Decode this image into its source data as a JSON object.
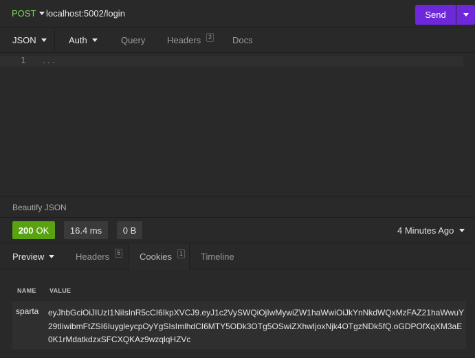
{
  "request": {
    "method": "POST",
    "url": "localhost:5002/login",
    "send_label": "Send"
  },
  "request_tabs": {
    "body": "JSON",
    "auth": "Auth",
    "query": "Query",
    "headers": "Headers",
    "headers_count": "2",
    "docs": "Docs"
  },
  "editor": {
    "line_number": "1",
    "placeholder": "..."
  },
  "beautify_label": "Beautify JSON",
  "response": {
    "status_code": "200",
    "status_text": "OK",
    "time": "16.4 ms",
    "size": "0 B",
    "ago": "4 Minutes Ago"
  },
  "response_tabs": {
    "preview": "Preview",
    "headers": "Headers",
    "headers_count": "6",
    "cookies": "Cookies",
    "cookies_count": "1",
    "timeline": "Timeline"
  },
  "cookies": {
    "columns": [
      "NAME",
      "VALUE"
    ],
    "rows": [
      {
        "name": "sparta",
        "value": "eyJhbGciOiJIUzI1NiIsInR5cCI6IkpXVCJ9.eyJ1c2VySWQiOjIwMywiZW1haWwiOiJkYnNkdWQxMzFAZ21haWwuY29tIiwibmFtZSI6IuygleycpOyYgSIsImlhdCI6MTY5ODk3OTg5OSwiZXhwIjoxNjk4OTgzNDk5fQ.oGDPOfXqXM3aE0K1rMdatkdzxSFCXQKAz9wzqlqHZVc"
      }
    ]
  },
  "colors": {
    "method": "#7fd85d",
    "send": "#6d28d9",
    "status_ok": "#59a210"
  }
}
